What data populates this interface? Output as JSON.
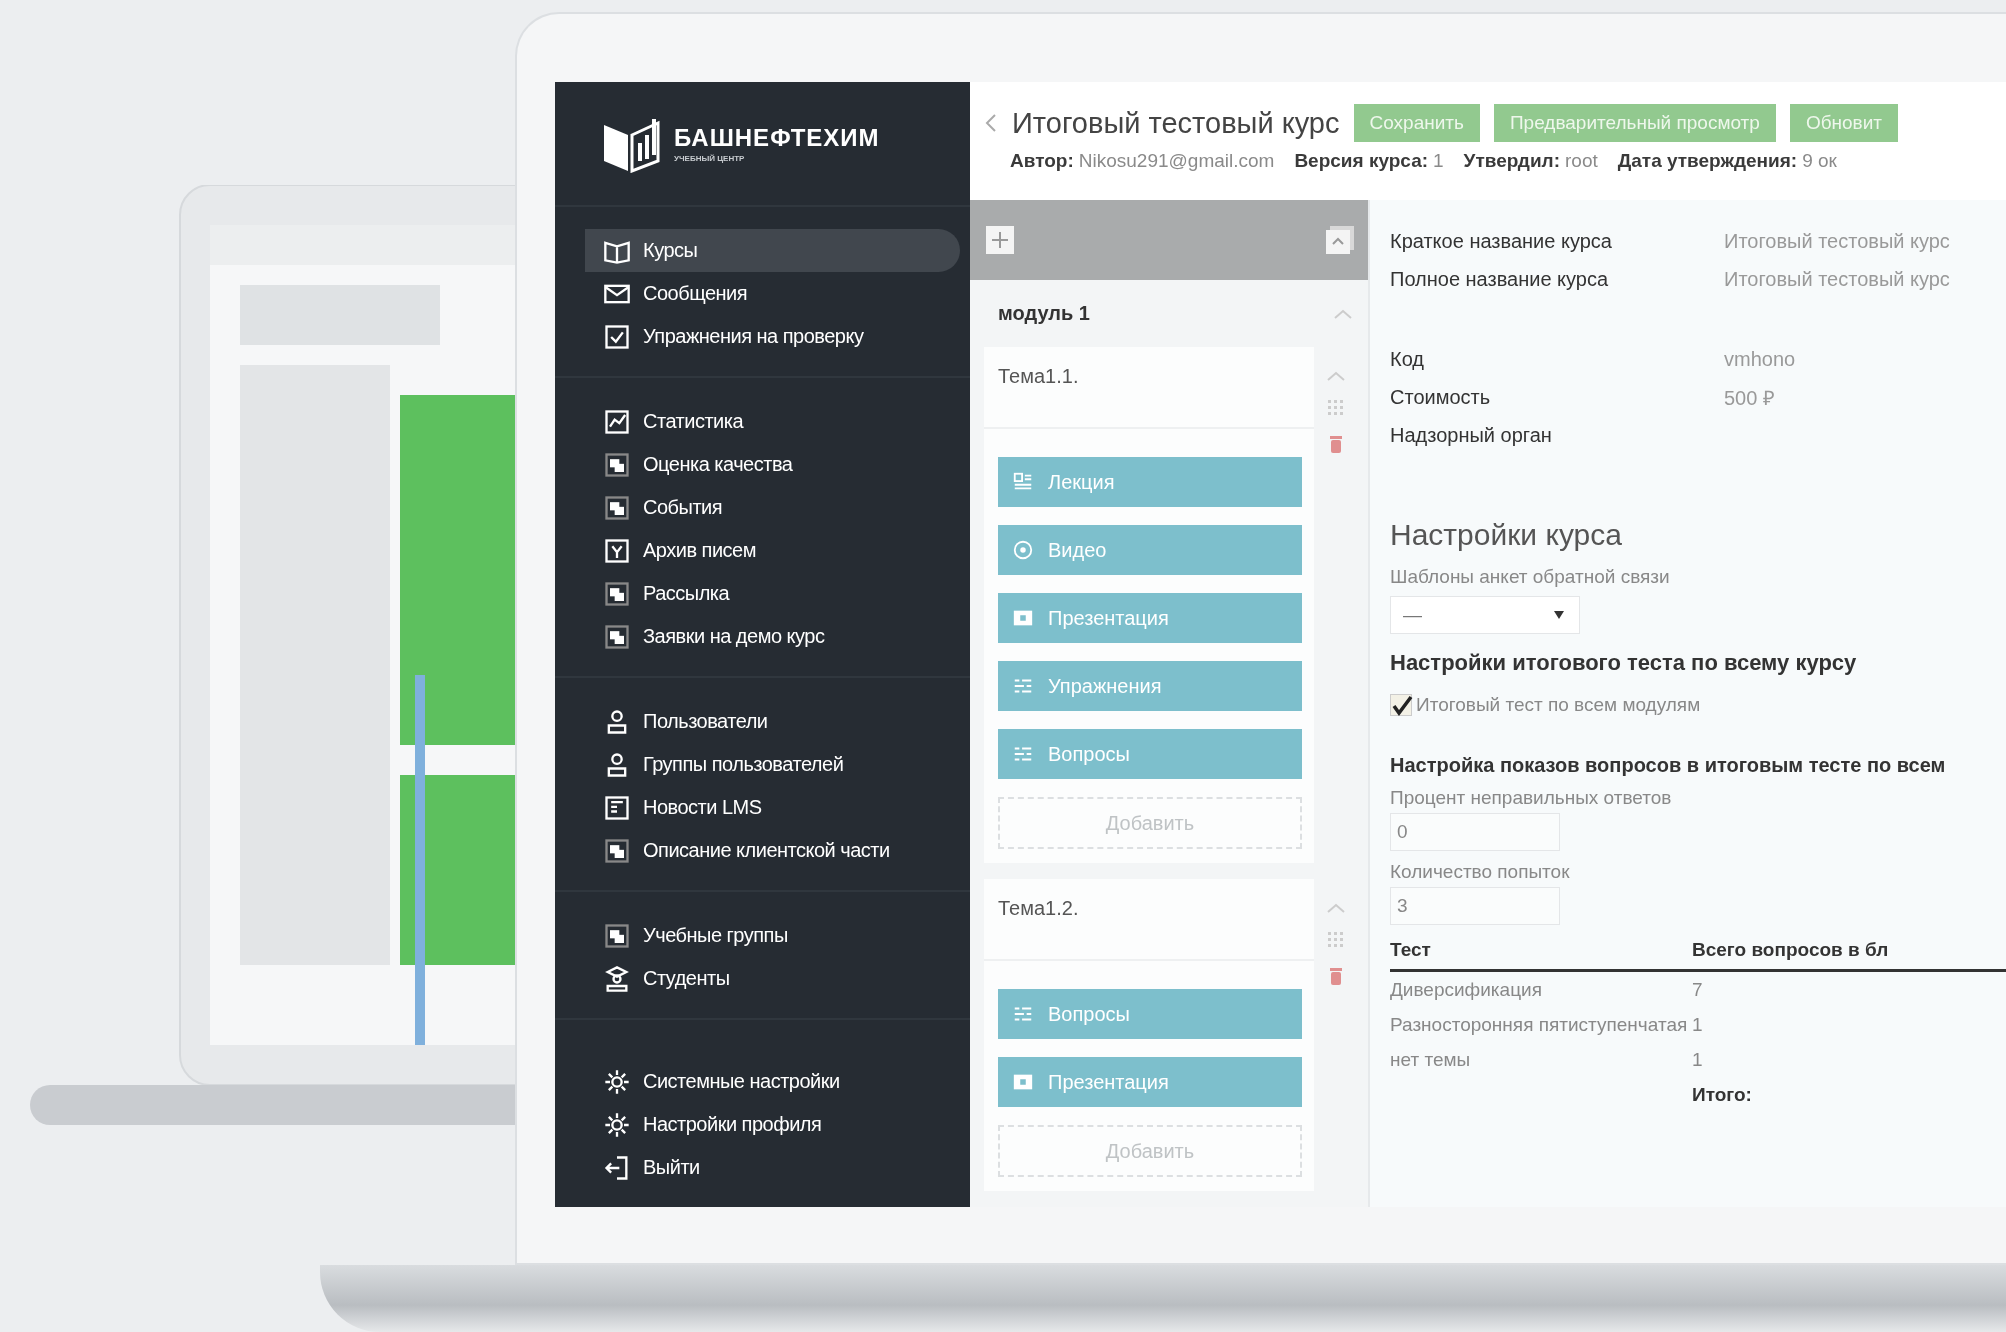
{
  "logo": {
    "name": "БАШНЕФТЕХИМ",
    "subtitle": "УЧЕБНЫЙ ЦЕНТР"
  },
  "sidebar": {
    "groups": [
      {
        "items": [
          {
            "label": "Курсы",
            "selected": true
          },
          {
            "label": "Сообщения",
            "selected": false
          },
          {
            "label": "Упражнения на проверку",
            "selected": false
          }
        ]
      },
      {
        "items": [
          {
            "label": "Статистика",
            "selected": false
          },
          {
            "label": "Оценка качества",
            "selected": false
          },
          {
            "label": "События",
            "selected": false
          },
          {
            "label": "Архив писем",
            "selected": false
          },
          {
            "label": "Рассылка",
            "selected": false
          },
          {
            "label": "Заявки на демо курс",
            "selected": false
          }
        ]
      },
      {
        "items": [
          {
            "label": "Пользователи",
            "selected": false
          },
          {
            "label": "Группы пользователей",
            "selected": false
          },
          {
            "label": "Новости LMS",
            "selected": false
          },
          {
            "label": "Описание клиентской части",
            "selected": false
          }
        ]
      },
      {
        "items": [
          {
            "label": "Учебные группы",
            "selected": false
          },
          {
            "label": "Студенты",
            "selected": false
          }
        ]
      },
      {
        "items": [
          {
            "label": "Системные настройки",
            "selected": false
          },
          {
            "label": "Настройки профиля",
            "selected": false
          },
          {
            "label": "Выйти",
            "selected": false
          }
        ]
      }
    ]
  },
  "header": {
    "title": "Итоговый тестовый курс",
    "buttons": [
      "Сохранить",
      "Предварительный просмотр",
      "Обновит"
    ],
    "meta": [
      {
        "label": "Автор:",
        "value": "Nikosu291@gmail.com"
      },
      {
        "label": "Версия курса:",
        "value": "1"
      },
      {
        "label": "Утвердил:",
        "value": "root"
      },
      {
        "label": "Дата утверждения:",
        "value": "9 ок"
      }
    ]
  },
  "modules": [
    {
      "title": "модуль 1",
      "topics": [
        {
          "title": "Тема1.1.",
          "materials": [
            {
              "kind": "lecture",
              "label": "Лекция"
            },
            {
              "kind": "video",
              "label": "Видео"
            },
            {
              "kind": "presentation",
              "label": "Презентация"
            },
            {
              "kind": "exercise",
              "label": "Упражнения"
            },
            {
              "kind": "questions",
              "label": "Вопросы"
            }
          ],
          "add": "Добавить"
        },
        {
          "title": "Тема1.2.",
          "materials": [
            {
              "kind": "questions",
              "label": "Вопросы"
            },
            {
              "kind": "presentation",
              "label": "Презентация"
            }
          ],
          "add": "Добавить"
        }
      ]
    }
  ],
  "details": {
    "fields": [
      {
        "label": "Краткое название курса",
        "value": "Итоговый тестовый курс"
      },
      {
        "label": "Полное название курса",
        "value": "Итоговый тестовый курс"
      },
      {
        "label": "Код",
        "value": "vmhono"
      },
      {
        "label": "Стоимость",
        "value": "500 ₽"
      },
      {
        "label": "Надзорный орган"
      }
    ]
  },
  "settings": {
    "title": "Настройки курса",
    "feedback_label": "Шаблоны анкет обратной связи",
    "feedback_value": "—",
    "final_title": "Настройки итогового теста по всему курсу",
    "final_checkbox": {
      "label": "Итоговый тест по всем модулям",
      "checked": true
    },
    "display_title": "Настройка показов вопросов в итоговым тесте по всем",
    "inputs": [
      {
        "label": "Процент неправильных ответов",
        "value": "0"
      },
      {
        "label": "Количество попыток",
        "value": "3"
      }
    ],
    "table": {
      "columns": [
        "Тест",
        "Всего вопросов в бл"
      ],
      "rows": [
        [
          "Диверсификация",
          "7"
        ],
        [
          "Разносторонняя пятиступенчатая",
          "1"
        ],
        [
          "нет темы",
          "1"
        ]
      ],
      "total_label": "Итого:"
    }
  }
}
